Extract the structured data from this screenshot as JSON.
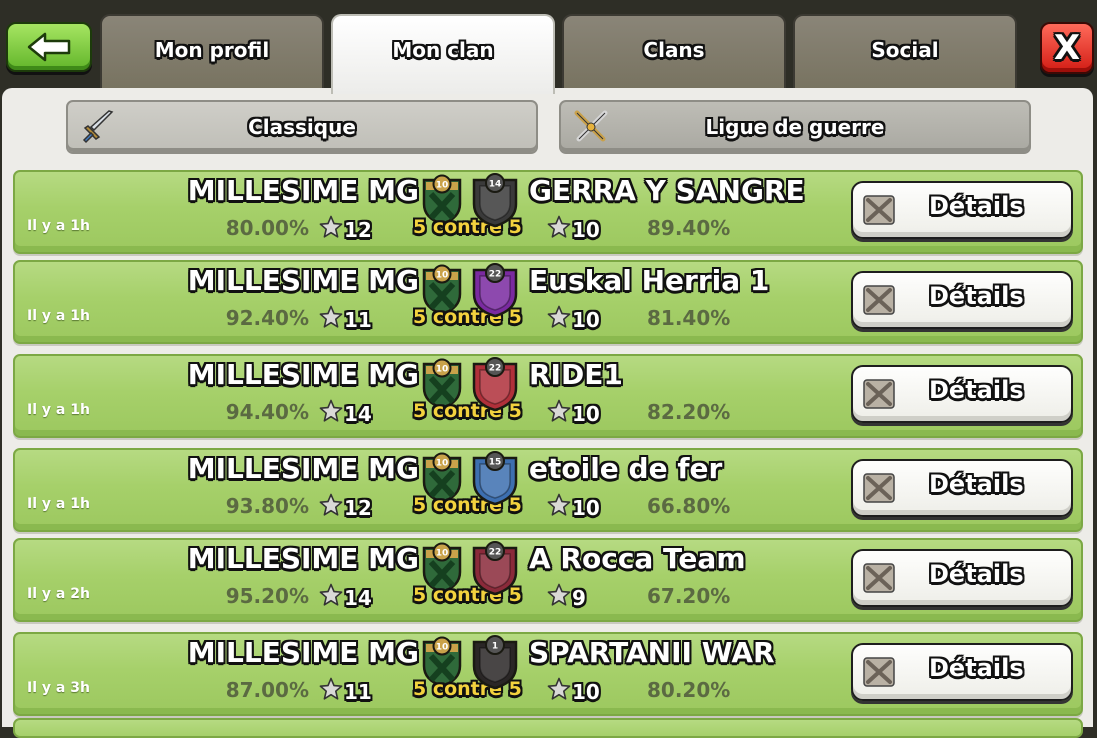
{
  "nav": {
    "tabs": [
      {
        "label": "Mon profil",
        "active": false
      },
      {
        "label": "Mon clan",
        "active": true
      },
      {
        "label": "Clans",
        "active": false
      },
      {
        "label": "Social",
        "active": false
      }
    ],
    "back_icon": "arrow-left-icon",
    "close_icon": "close-x-icon",
    "close_label": "X"
  },
  "subtabs": [
    {
      "label": "Classique",
      "icon": "sword-icon",
      "active": true
    },
    {
      "label": "Ligue de guerre",
      "icon": "crossed-swords-icon",
      "active": false
    }
  ],
  "colors": {
    "row_green": "#a6d06a",
    "back_green": "#62b52a",
    "close_red": "#d21c14",
    "versus_yellow": "#f3d23e"
  },
  "wars": [
    {
      "time": "Il y a 1h",
      "home_name": "MILLESIME MG",
      "home_pct": "80.00%",
      "home_stars": "12",
      "home_level": "10",
      "versus": "5 contre 5",
      "opp_name": "GERRA Y SANGRE",
      "opp_level": "14",
      "opp_stars": "10",
      "opp_pct": "89.40%",
      "opp_badge_color": "#3a3a3a",
      "details_label": "Détails"
    },
    {
      "time": "Il y a 1h",
      "home_name": "MILLESIME MG",
      "home_pct": "92.40%",
      "home_stars": "11",
      "home_level": "10",
      "versus": "5 contre 5",
      "opp_name": "Euskal Herria 1",
      "opp_level": "22",
      "opp_stars": "10",
      "opp_pct": "81.40%",
      "opp_badge_color": "#7a2aa0",
      "details_label": "Détails"
    },
    {
      "time": "Il y a 1h",
      "home_name": "MILLESIME MG",
      "home_pct": "94.40%",
      "home_stars": "14",
      "home_level": "10",
      "versus": "5 contre 5",
      "opp_name": "RIDE1",
      "opp_level": "22",
      "opp_stars": "10",
      "opp_pct": "82.20%",
      "opp_badge_color": "#b0303a",
      "details_label": "Détails"
    },
    {
      "time": "Il y a 1h",
      "home_name": "MILLESIME MG",
      "home_pct": "93.80%",
      "home_stars": "12",
      "home_level": "10",
      "versus": "5 contre 5",
      "opp_name": "etoile de fer",
      "opp_level": "15",
      "opp_stars": "10",
      "opp_pct": "66.80%",
      "opp_badge_color": "#3d6fb0",
      "details_label": "Détails"
    },
    {
      "time": "Il y a 2h",
      "home_name": "MILLESIME MG",
      "home_pct": "95.20%",
      "home_stars": "14",
      "home_level": "10",
      "versus": "5 contre 5",
      "opp_name": "A Rocca Team",
      "opp_level": "22",
      "opp_stars": "9",
      "opp_pct": "67.20%",
      "opp_badge_color": "#8a2a3a",
      "details_label": "Détails"
    },
    {
      "time": "Il y a 3h",
      "home_name": "MILLESIME MG",
      "home_pct": "87.00%",
      "home_stars": "11",
      "home_level": "10",
      "versus": "5 contre 5",
      "opp_name": "SPARTANII WAR",
      "opp_level": "1",
      "opp_stars": "10",
      "opp_pct": "80.20%",
      "opp_badge_color": "#2a2626",
      "details_label": "Détails"
    }
  ]
}
